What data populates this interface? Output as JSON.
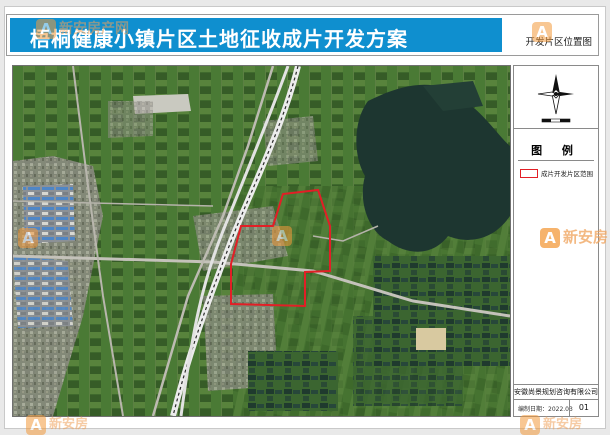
{
  "header": {
    "title": "梧桐健康小镇片区土地征收成片开发方案",
    "subtitle": "开发片区位置图"
  },
  "legend": {
    "heading": "图  例",
    "items": [
      {
        "label": "成片开发片区范围",
        "color": "#e21f26"
      }
    ]
  },
  "footer": {
    "organization": "安徽尚景规划咨询有限公司",
    "date_label": "编制日期：2022.03",
    "sheet_number": "01"
  },
  "map": {
    "base": "satellite imagery",
    "boundary_color": "#e21f26",
    "railway_color": "#f4f4f4",
    "water_color": "#1f3b33"
  },
  "compass": {
    "north_label": "N",
    "icon": "north-arrow-icon"
  },
  "watermarks": {
    "text": "新安房产网",
    "short": "新安房",
    "letter": "A",
    "color": "#f39a3c"
  }
}
